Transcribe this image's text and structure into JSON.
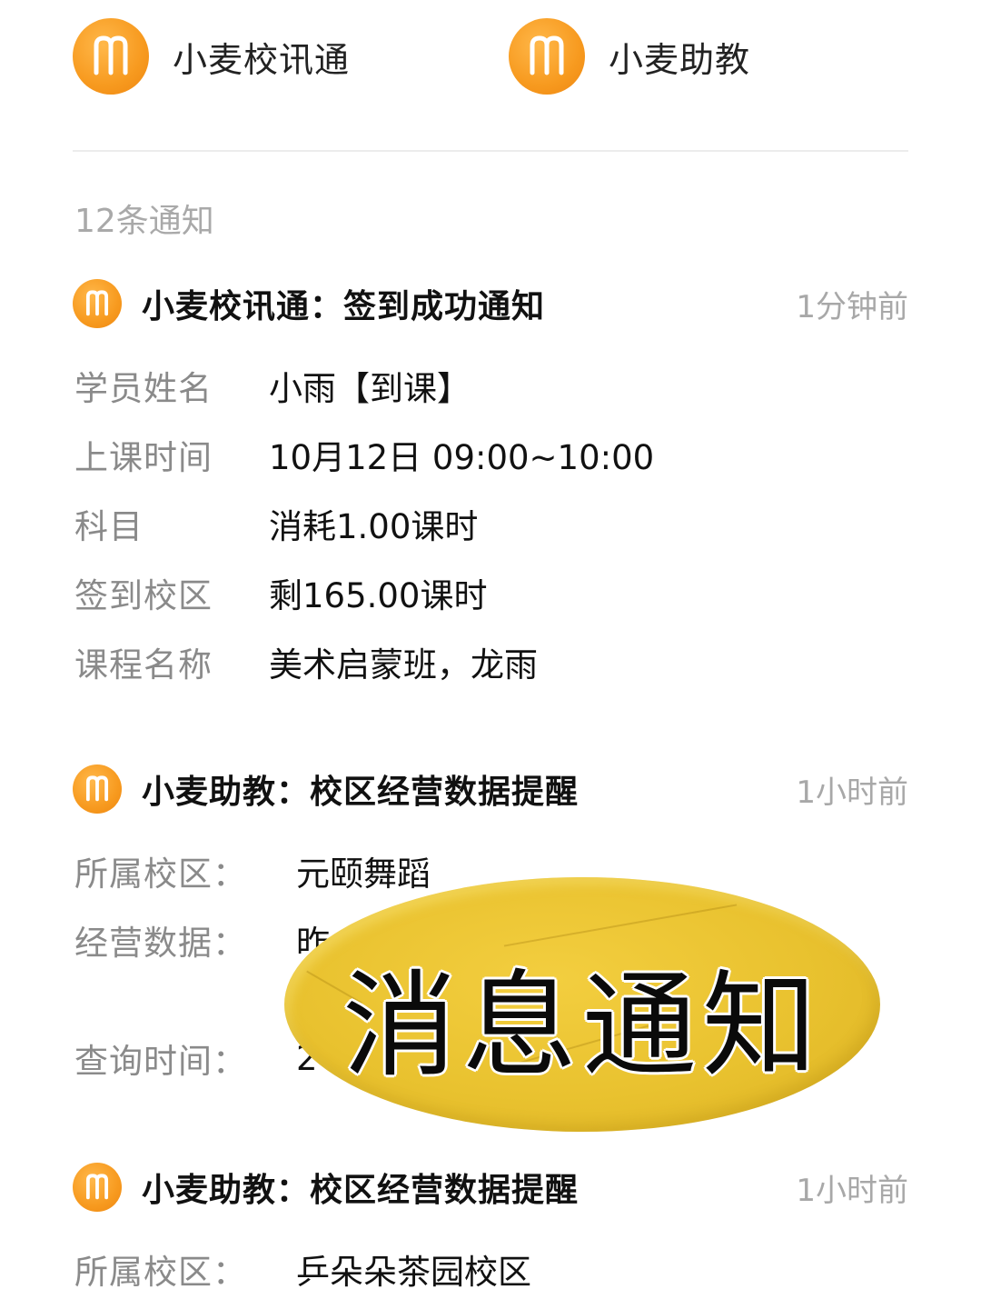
{
  "apps": [
    {
      "name": "小麦校讯通"
    },
    {
      "name": "小麦助教"
    }
  ],
  "notification_count": "12条通知",
  "notifications": [
    {
      "title": "小麦校讯通：签到成功通知",
      "time": "1分钟前",
      "fields": [
        {
          "label": "学员姓名",
          "value": "小雨【到课】"
        },
        {
          "label": "上课时间",
          "value": "10月12日 09:00~10:00"
        },
        {
          "label": "科目",
          "value": "消耗1.00课时"
        },
        {
          "label": "签到校区",
          "value": "剩165.00课时"
        },
        {
          "label": "课程名称",
          "value": "美术启蒙班，龙雨"
        }
      ]
    },
    {
      "title": "小麦助教：校区经营数据提醒",
      "time": "1小时前",
      "fields": [
        {
          "label": "所属校区：",
          "value": "元颐舞蹈"
        },
        {
          "label": "经营数据：",
          "value": "昨"
        },
        {
          "label": "查询时间：",
          "value": "2"
        }
      ]
    },
    {
      "title": "小麦助教：校区经营数据提醒",
      "time": "1小时前",
      "fields": [
        {
          "label": "所属校区：",
          "value": "乒朵朵茶园校区"
        }
      ]
    }
  ],
  "sticker": {
    "text": "消息通知",
    "color": "#e9c22f"
  },
  "colors": {
    "brand_orange": "#f79a1f",
    "muted_gray": "#a8a8a8"
  }
}
